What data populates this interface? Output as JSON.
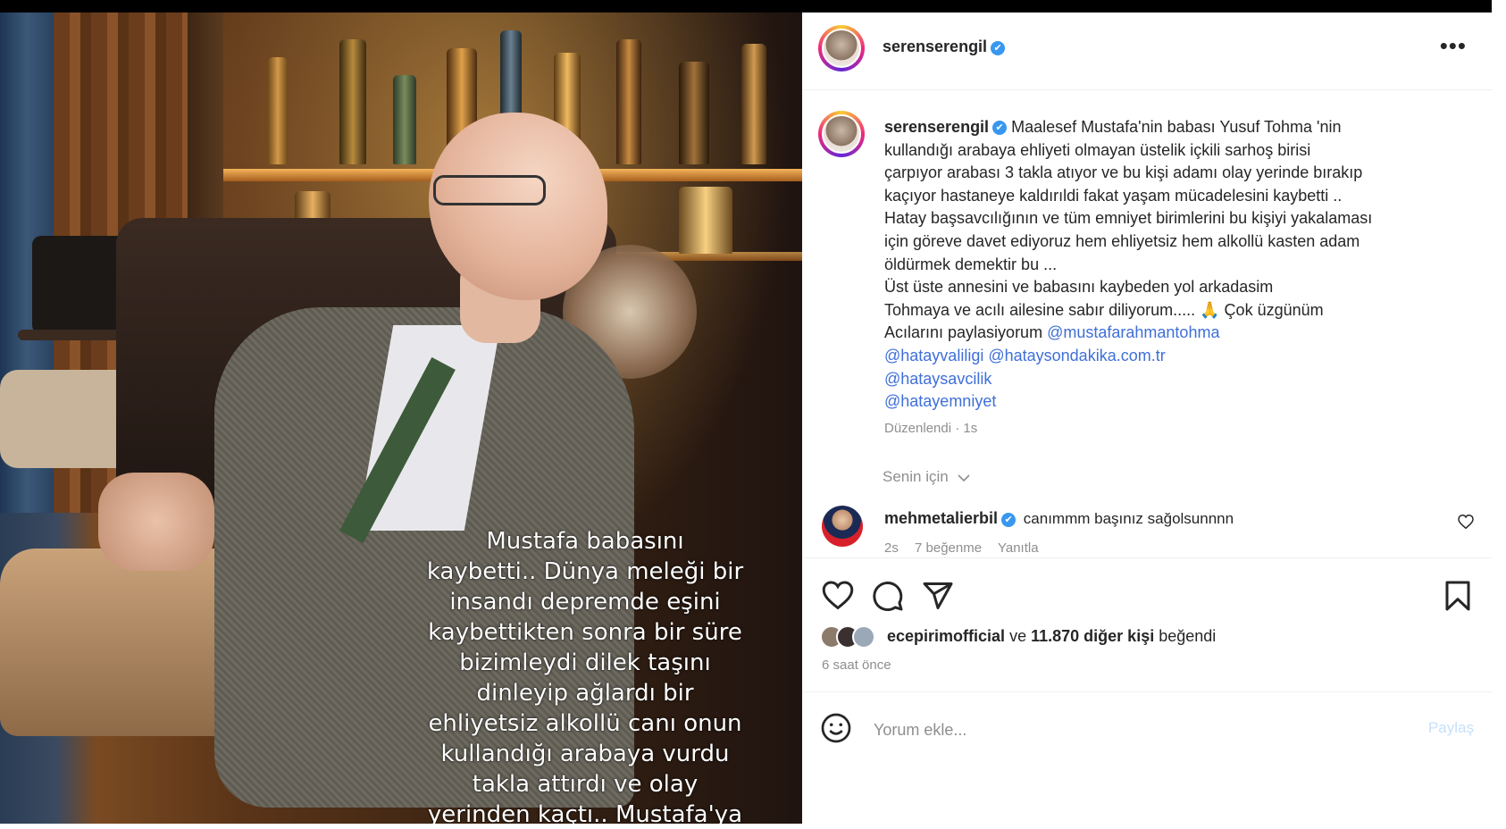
{
  "post": {
    "username": "serenserengil",
    "verified_mark": "✔",
    "more_label": "•••"
  },
  "photo": {
    "overlay_lines": [
      "Mustafa babasını",
      "kaybetti.. Dünya meleği bir",
      "insandı depremde eşini",
      "kaybettikten sonra bir süre",
      "bizimleydi dilek taşını",
      "dinleyip ağlardı bir",
      "ehliyetsiz alkollü canı onun",
      "kullandığı arabaya vurdu",
      "takla attırdı ve olay",
      "yerinden kaçtı.. Mustafa'ya"
    ]
  },
  "caption": {
    "username": "serenserengil",
    "lines": [
      "Maalesef Mustafa'nin babası Yusuf Tohma 'nin",
      "kullandığı arabaya ehliyeti olmayan üstelik içkili sarhoş birisi",
      "çarpıyor arabası 3 takla atıyor ve bu kişi adamı olay yerinde bırakıp",
      "kaçıyor hastaneye kaldırıldi fakat yaşam mücadelesini kaybetti ..",
      "Hatay başsavcılığının ve tüm emniyet birimlerini bu kişiyi yakalaması",
      "için göreve davet ediyoruz hem ehliyetsiz hem alkollü kasten adam",
      "öldürmek demektir bu ...",
      "Üst üste annesini ve babasını kaybeden yol arkadasim",
      "Tohmaya ve acılı ailesine sabır diliyorum..... 🙏 Çok üzgünüm",
      "Acılarını paylasiyorum"
    ],
    "mention_inline": "@mustafarahmantohma",
    "mentions": [
      "@hatayvaliligi",
      "@hataysondakika.com.tr",
      "@hataysavcilik",
      "@hatayemniyet"
    ],
    "meta": "Düzenlendi · 1s"
  },
  "for_you_label": "Senin için",
  "comment": {
    "username": "mehmetalierbil",
    "text": "canımmm başınız sağolsunnnn",
    "time": "2s",
    "likes": "7 beğenme",
    "reply": "Yanıtla"
  },
  "actions": {
    "like_icon": "heart-icon",
    "comment_icon": "comment-icon",
    "share_icon": "share-icon",
    "save_icon": "bookmark-icon"
  },
  "likes": {
    "first_user": "ecepirimofficial",
    "connector": "ve",
    "others": "11.870 diğer kişi",
    "suffix": "beğendi"
  },
  "time_ago": "6 saat önce",
  "comment_box": {
    "placeholder": "Yorum ekle...",
    "post_label": "Paylaş"
  },
  "colors": {
    "verified": "#3897f0",
    "mention": "#3f6fd8",
    "muted": "#8e8e8e",
    "post_disabled": "#c7e0fb"
  }
}
